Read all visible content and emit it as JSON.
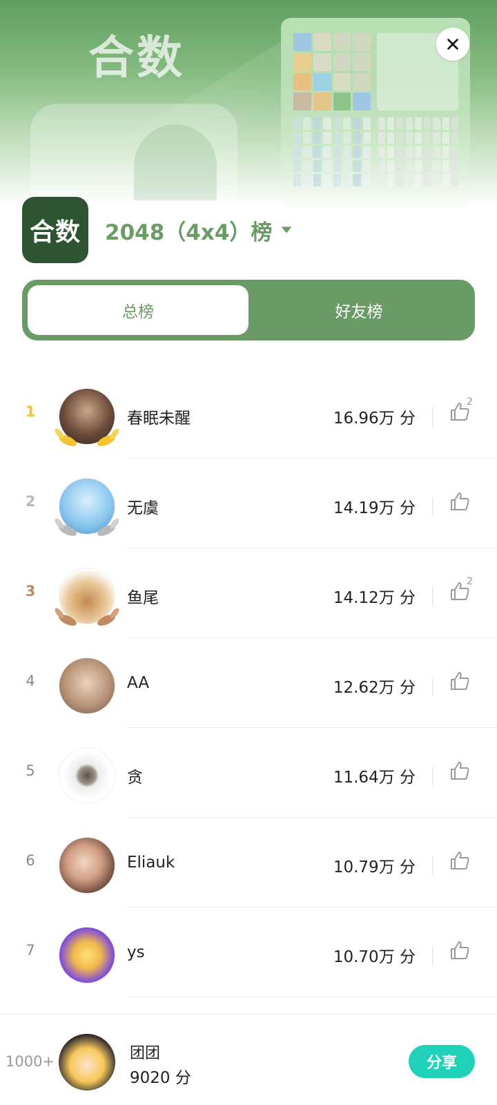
{
  "header": {
    "title": "合数",
    "logo_text": "合数",
    "board_label": "2048（4x4）榜"
  },
  "tabs": [
    {
      "label": "总榜",
      "active": true
    },
    {
      "label": "好友榜",
      "active": false
    }
  ],
  "colors": {
    "brand_green": "#6a9a66",
    "logo_bg": "#2e5330",
    "gold": "#f3c430",
    "silver": "#b9b9b9",
    "bronze": "#c08a60",
    "share": "#1ed1b8"
  },
  "leaderboard": [
    {
      "rank": "1",
      "name": "春眠未醒",
      "score": "16.96万 分",
      "likes": "2"
    },
    {
      "rank": "2",
      "name": "无虞",
      "score": "14.19万 分",
      "likes": ""
    },
    {
      "rank": "3",
      "name": "鱼尾",
      "score": "14.12万 分",
      "likes": "2"
    },
    {
      "rank": "4",
      "name": "AA",
      "score": "12.62万 分",
      "likes": ""
    },
    {
      "rank": "5",
      "name": "贪",
      "score": "11.64万 分",
      "likes": ""
    },
    {
      "rank": "6",
      "name": "Eliauk",
      "score": "10.79万 分",
      "likes": ""
    },
    {
      "rank": "7",
      "name": "ys",
      "score": "10.70万 分",
      "likes": ""
    }
  ],
  "me": {
    "rank": "1000+",
    "name": "团团",
    "score": "9020 分",
    "share_label": "分享"
  },
  "icons": {
    "close": "close-icon",
    "dropdown": "caret-down-icon",
    "like": "thumbs-up-icon"
  }
}
